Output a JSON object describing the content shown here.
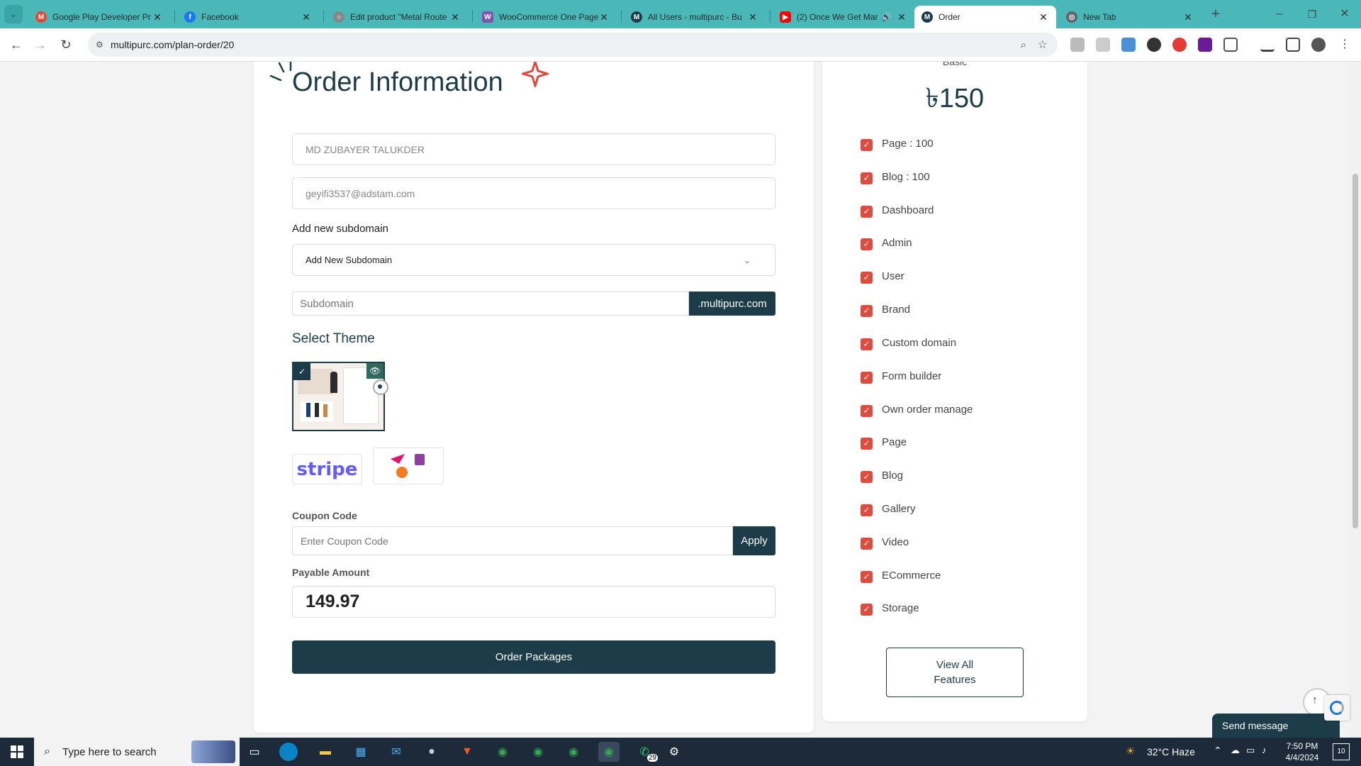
{
  "browser": {
    "tabs": [
      {
        "title": "Google Play Developer Pr",
        "icon": "gmail-icon",
        "color": "#ea4335"
      },
      {
        "title": "Facebook",
        "icon": "facebook-icon",
        "color": "#1877f2"
      },
      {
        "title": "Edit product \"Metal Route",
        "icon": "globe-icon",
        "color": "#888888"
      },
      {
        "title": "WooCommerce One Page",
        "icon": "woo-icon",
        "color": "#7f54b3"
      },
      {
        "title": "All Users - multipurc - Bu",
        "icon": "m-icon",
        "color": "#1d3c4a"
      },
      {
        "title": "(2) Once We Get Mar",
        "icon": "youtube-icon",
        "color": "#ff0000"
      },
      {
        "title": "Order",
        "icon": "m-icon",
        "color": "#1d3c4a",
        "active": true
      },
      {
        "title": "New Tab",
        "icon": "chrome-icon",
        "color": "#5f6368"
      }
    ],
    "url": "multipurc.com/plan-order/20"
  },
  "order": {
    "title": "Order Information",
    "name_value": "MD ZUBAYER TALUKDER",
    "email_value": "geyifi3537@adstam.com",
    "subdomain_label": "Add new subdomain",
    "subdomain_select": "Add New Subdomain",
    "subdomain_placeholder": "Subdomain",
    "subdomain_suffix": ".multipurc.com",
    "theme_label": "Select Theme",
    "payment_stripe": "stripe",
    "coupon_label": "Coupon Code",
    "coupon_placeholder": "Enter Coupon Code",
    "apply_label": "Apply",
    "payable_label": "Payable Amount",
    "payable_value": "149.97",
    "order_button": "Order Packages"
  },
  "plan": {
    "name": "Basic",
    "price": "৳150",
    "features": [
      "Page : 100",
      "Blog : 100",
      "Dashboard",
      "Admin",
      "User",
      "Brand",
      "Custom domain",
      "Form builder",
      "Own order manage",
      "Page",
      "Blog",
      "Gallery",
      "Video",
      "ECommerce",
      "Storage"
    ],
    "view_all": "View All\nFeatures"
  },
  "widget": {
    "send_message": "Send message"
  },
  "taskbar": {
    "search_placeholder": "Type here to search",
    "weather": "32°C  Haze",
    "time": "7:50 PM",
    "date": "4/4/2024",
    "whatsapp_badge": "29",
    "notif_count": "10"
  },
  "colors": {
    "accent": "#1d3c4a",
    "check": "#e04b3d",
    "tabbar": "#4ab8b8"
  }
}
